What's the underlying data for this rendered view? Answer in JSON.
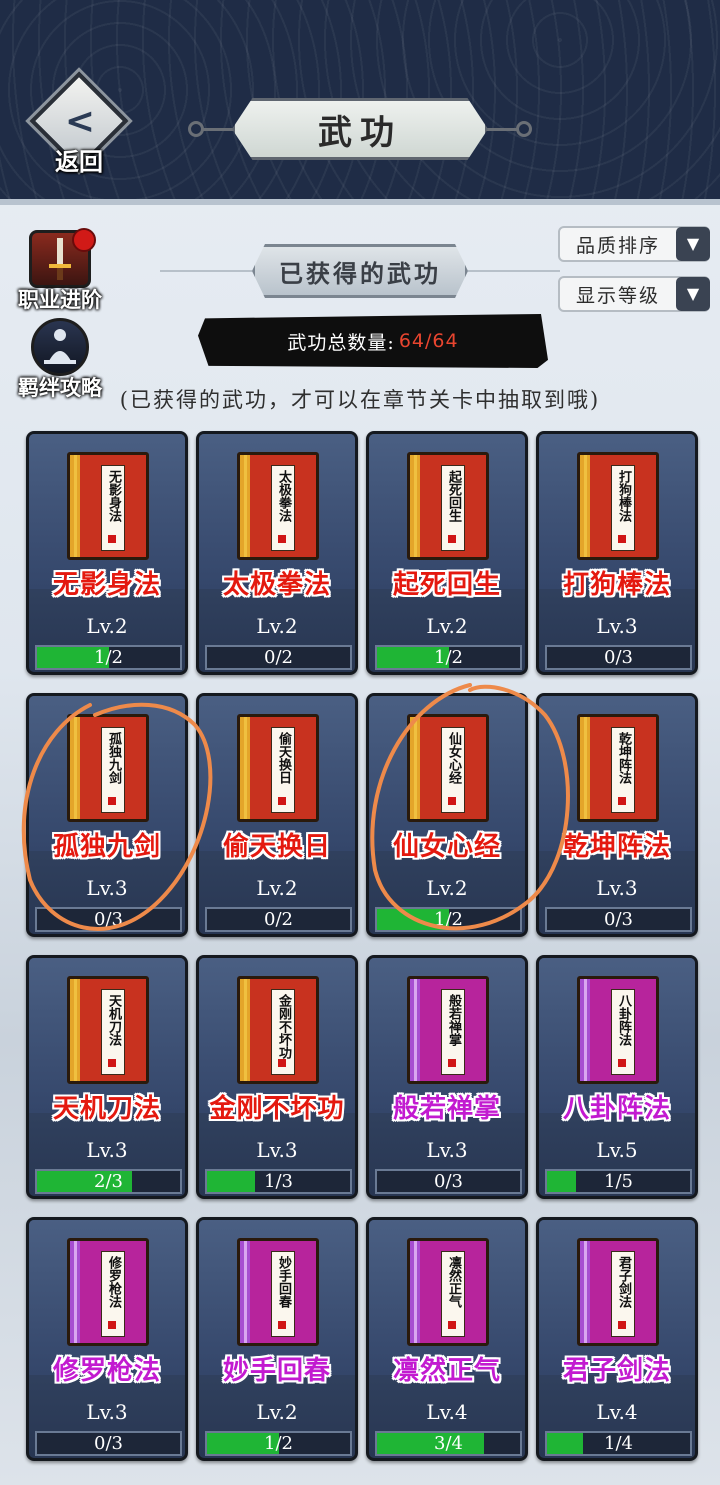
{
  "header": {
    "title": "武功",
    "back_label": "返回"
  },
  "side": {
    "career_label": "职业进阶",
    "bond_label": "羁绊攻略"
  },
  "dropdowns": {
    "quality_sort": "品质排序",
    "show_level": "显示等级"
  },
  "section_title": "已获得的武功",
  "count": {
    "label": "武功总数量:",
    "value": "64/64"
  },
  "hint": "(已获得的武功，才可以在章节关卡中抽取到哦)",
  "colors": {
    "orange_name": "#e4190f",
    "purple_name": "#c21ad0",
    "progress": "#1fb535",
    "annotation": "#ee8a4a"
  },
  "cards": [
    {
      "name": "无影身法",
      "level": "Lv.2",
      "progress": "1/2",
      "fill": 0.5,
      "rarity": "orange"
    },
    {
      "name": "太极拳法",
      "level": "Lv.2",
      "progress": "0/2",
      "fill": 0,
      "rarity": "orange"
    },
    {
      "name": "起死回生",
      "level": "Lv.2",
      "progress": "1/2",
      "fill": 0.5,
      "rarity": "orange"
    },
    {
      "name": "打狗棒法",
      "level": "Lv.3",
      "progress": "0/3",
      "fill": 0,
      "rarity": "orange"
    },
    {
      "name": "孤独九剑",
      "level": "Lv.3",
      "progress": "0/3",
      "fill": 0,
      "rarity": "orange"
    },
    {
      "name": "偷天换日",
      "level": "Lv.2",
      "progress": "0/2",
      "fill": 0,
      "rarity": "orange"
    },
    {
      "name": "仙女心经",
      "level": "Lv.2",
      "progress": "1/2",
      "fill": 0.5,
      "rarity": "orange"
    },
    {
      "name": "乾坤阵法",
      "level": "Lv.3",
      "progress": "0/3",
      "fill": 0,
      "rarity": "orange"
    },
    {
      "name": "天机刀法",
      "level": "Lv.3",
      "progress": "2/3",
      "fill": 0.667,
      "rarity": "orange"
    },
    {
      "name": "金刚不坏功",
      "level": "Lv.3",
      "progress": "1/3",
      "fill": 0.333,
      "rarity": "orange"
    },
    {
      "name": "般若禅掌",
      "level": "Lv.3",
      "progress": "0/3",
      "fill": 0,
      "rarity": "purple"
    },
    {
      "name": "八卦阵法",
      "level": "Lv.5",
      "progress": "1/5",
      "fill": 0.2,
      "rarity": "purple"
    },
    {
      "name": "修罗枪法",
      "level": "Lv.3",
      "progress": "0/3",
      "fill": 0,
      "rarity": "purple"
    },
    {
      "name": "妙手回春",
      "level": "Lv.2",
      "progress": "1/2",
      "fill": 0.5,
      "rarity": "purple"
    },
    {
      "name": "凛然正气",
      "level": "Lv.4",
      "progress": "3/4",
      "fill": 0.75,
      "rarity": "purple"
    },
    {
      "name": "君子剑法",
      "level": "Lv.4",
      "progress": "1/4",
      "fill": 0.25,
      "rarity": "purple"
    }
  ],
  "annotations": {
    "circled_cards": [
      "孤独九剑",
      "仙女心经"
    ]
  }
}
